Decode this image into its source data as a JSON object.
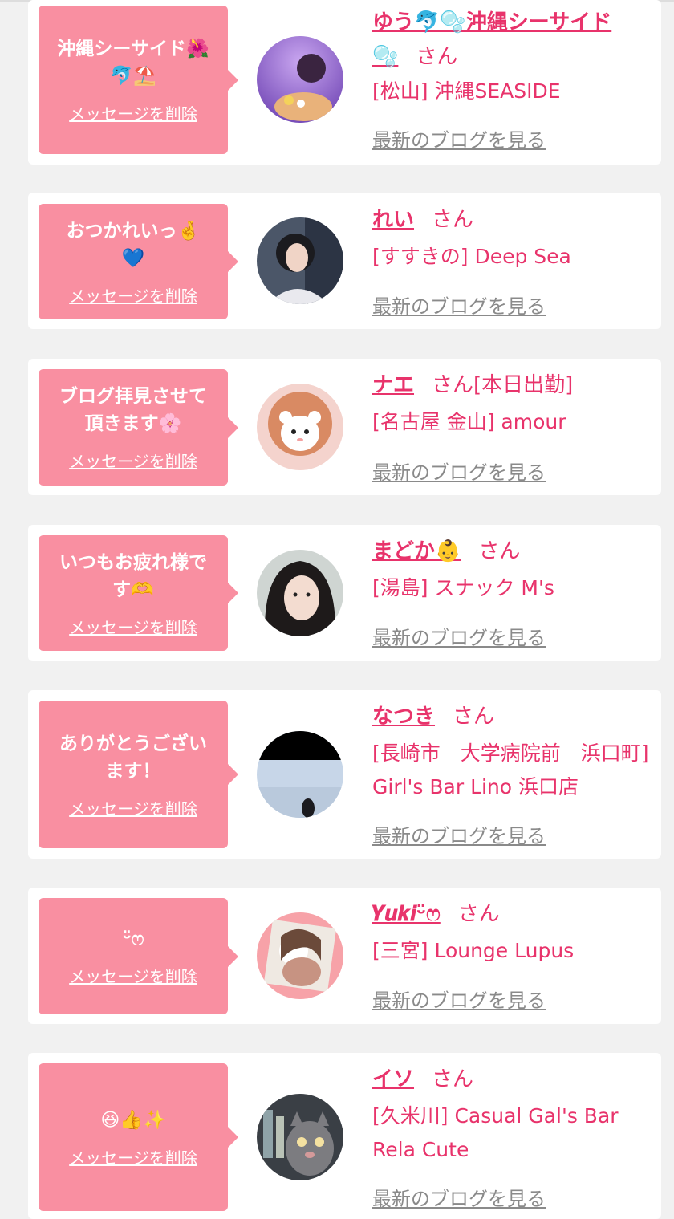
{
  "common": {
    "san": "さん",
    "delete_label": "メッセージを削除",
    "blog_label": "最新のブログを見る"
  },
  "items": [
    {
      "message": "沖縄シーサイド🌺\n🐬⛱️",
      "name": "ゆう🐬🫧沖縄シーサイド\n🫧",
      "status": "",
      "shop": "[松山] 沖縄SEASIDE",
      "avatar_icon": "avatar-photo"
    },
    {
      "message": "おつかれいっ🤞\n💙",
      "name": "れい",
      "status": "",
      "shop": "[すすきの] Deep Sea",
      "avatar_icon": "avatar-photo"
    },
    {
      "message": "ブログ拝見させて\n頂きます🌸",
      "name": "ナエ",
      "status": "[本日出勤]",
      "shop": "[名古屋 金山] amour",
      "avatar_icon": "avatar-photo"
    },
    {
      "message": "いつもお疲れ様で\nす🫶",
      "name": "まどか👶",
      "status": "",
      "shop": "[湯島] スナック M's",
      "avatar_icon": "avatar-photo"
    },
    {
      "message": "ありがとうござい\nます！",
      "name": "なつき",
      "status": "",
      "shop": "[長崎市　大学病院前　浜口町] Girl's Bar Lino 浜口店",
      "avatar_icon": "avatar-photo"
    },
    {
      "message": "ᵕ̈ෆ",
      "name": "𝒀𝒖𝒌𝒊ᵕ̈ෆ",
      "status": "",
      "shop": "[三宮] Lounge Lupus",
      "avatar_icon": "avatar-photo"
    },
    {
      "message": "😆👍✨",
      "name": "イソ",
      "status": "",
      "shop": "[久米川] Casual Gal's Bar Rela Cute",
      "avatar_icon": "avatar-photo"
    }
  ]
}
